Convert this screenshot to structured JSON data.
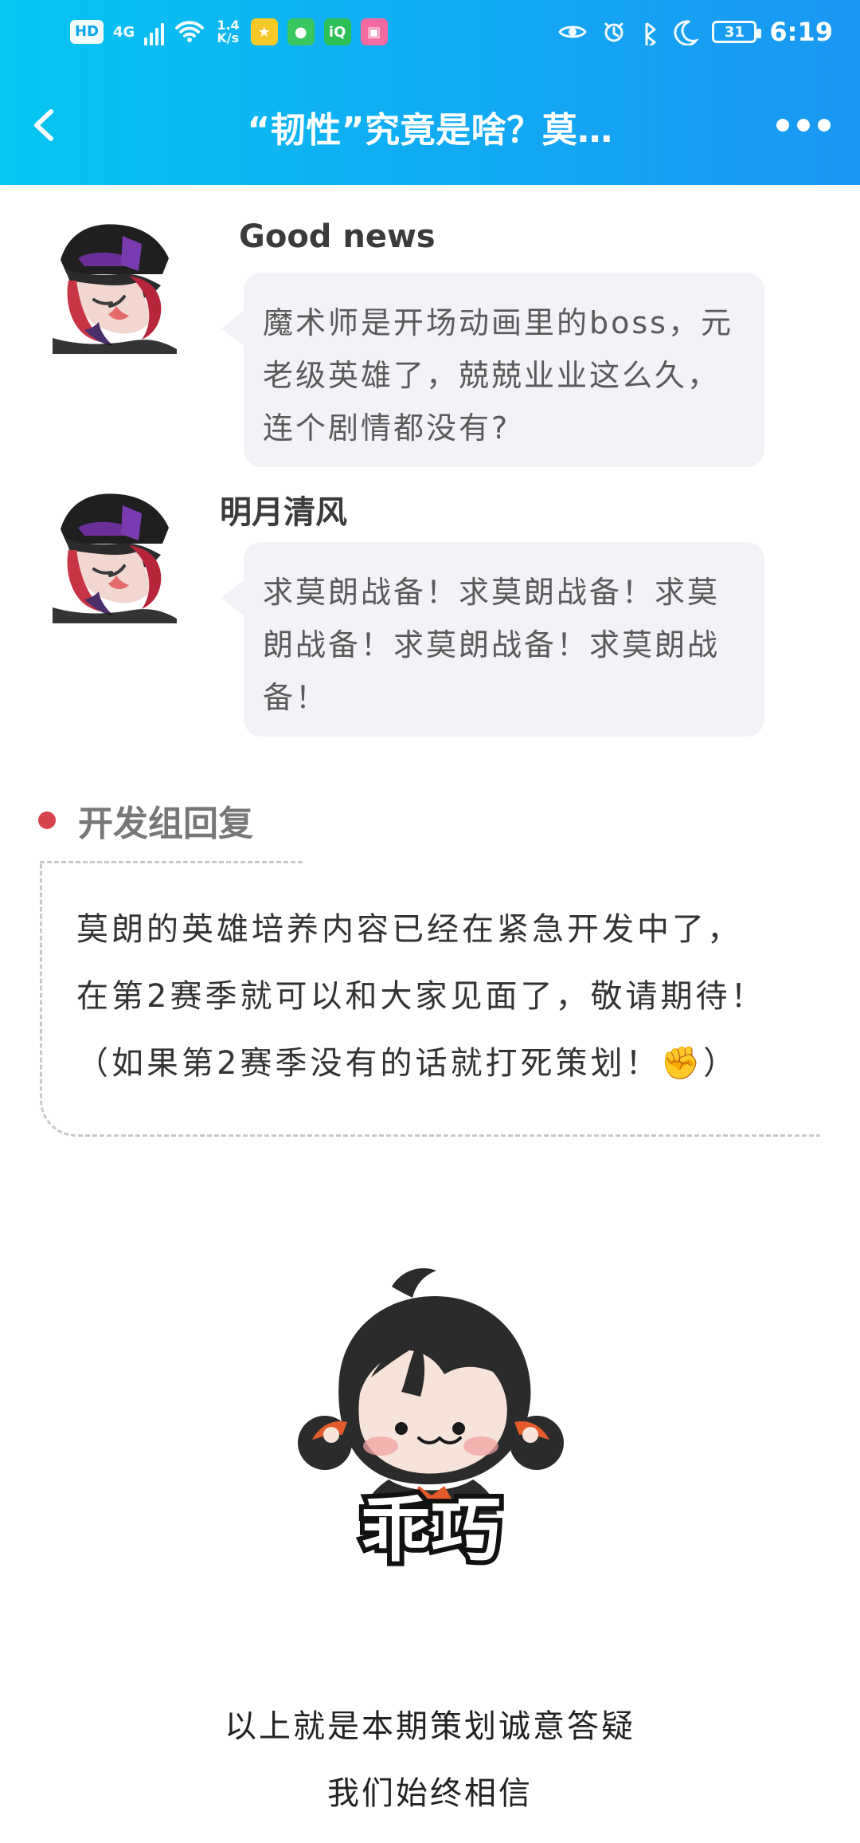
{
  "status_bar": {
    "left": {
      "hd": "HD",
      "network": "4G",
      "speed_top": "1.4",
      "speed_bottom": "K/s"
    },
    "right": {
      "battery": "31",
      "time": "6:19"
    }
  },
  "nav": {
    "title": "“韧性”究竟是啥？莫…"
  },
  "comments": [
    {
      "author": "Good news",
      "text": "魔术师是开场动画里的boss，元老级英雄了，兢兢业业这么久，连个剧情都没有?"
    },
    {
      "author": "明月清风",
      "text": "求莫朗战备！求莫朗战备！求莫朗战备！求莫朗战备！求莫朗战备！"
    }
  ],
  "dev_reply": {
    "title": "开发组回复",
    "lines": [
      "莫朗的英雄培养内容已经在紧急开发中了，",
      "在第2赛季就可以和大家见面了，敬请期待！",
      "（如果第2赛季没有的话就打死策划！✊）"
    ]
  },
  "sticker": {
    "caption": "乖巧"
  },
  "footer": {
    "lines": [
      "以上就是本期策划诚意答疑",
      "我们始终相信"
    ]
  },
  "colors": {
    "header_start": "#05c6f1",
    "header_end": "#1a97f3",
    "bubble_bg": "#f2f3f7",
    "accent_red": "#d6454b"
  },
  "icons": {
    "back": "chevron-left-icon",
    "more": "more-horizontal-icon",
    "wifi": "wifi-icon",
    "signal": "signal-icon",
    "eye": "eye-icon",
    "alarm": "alarm-icon",
    "bluetooth": "bluetooth-icon",
    "moon": "moon-icon"
  }
}
